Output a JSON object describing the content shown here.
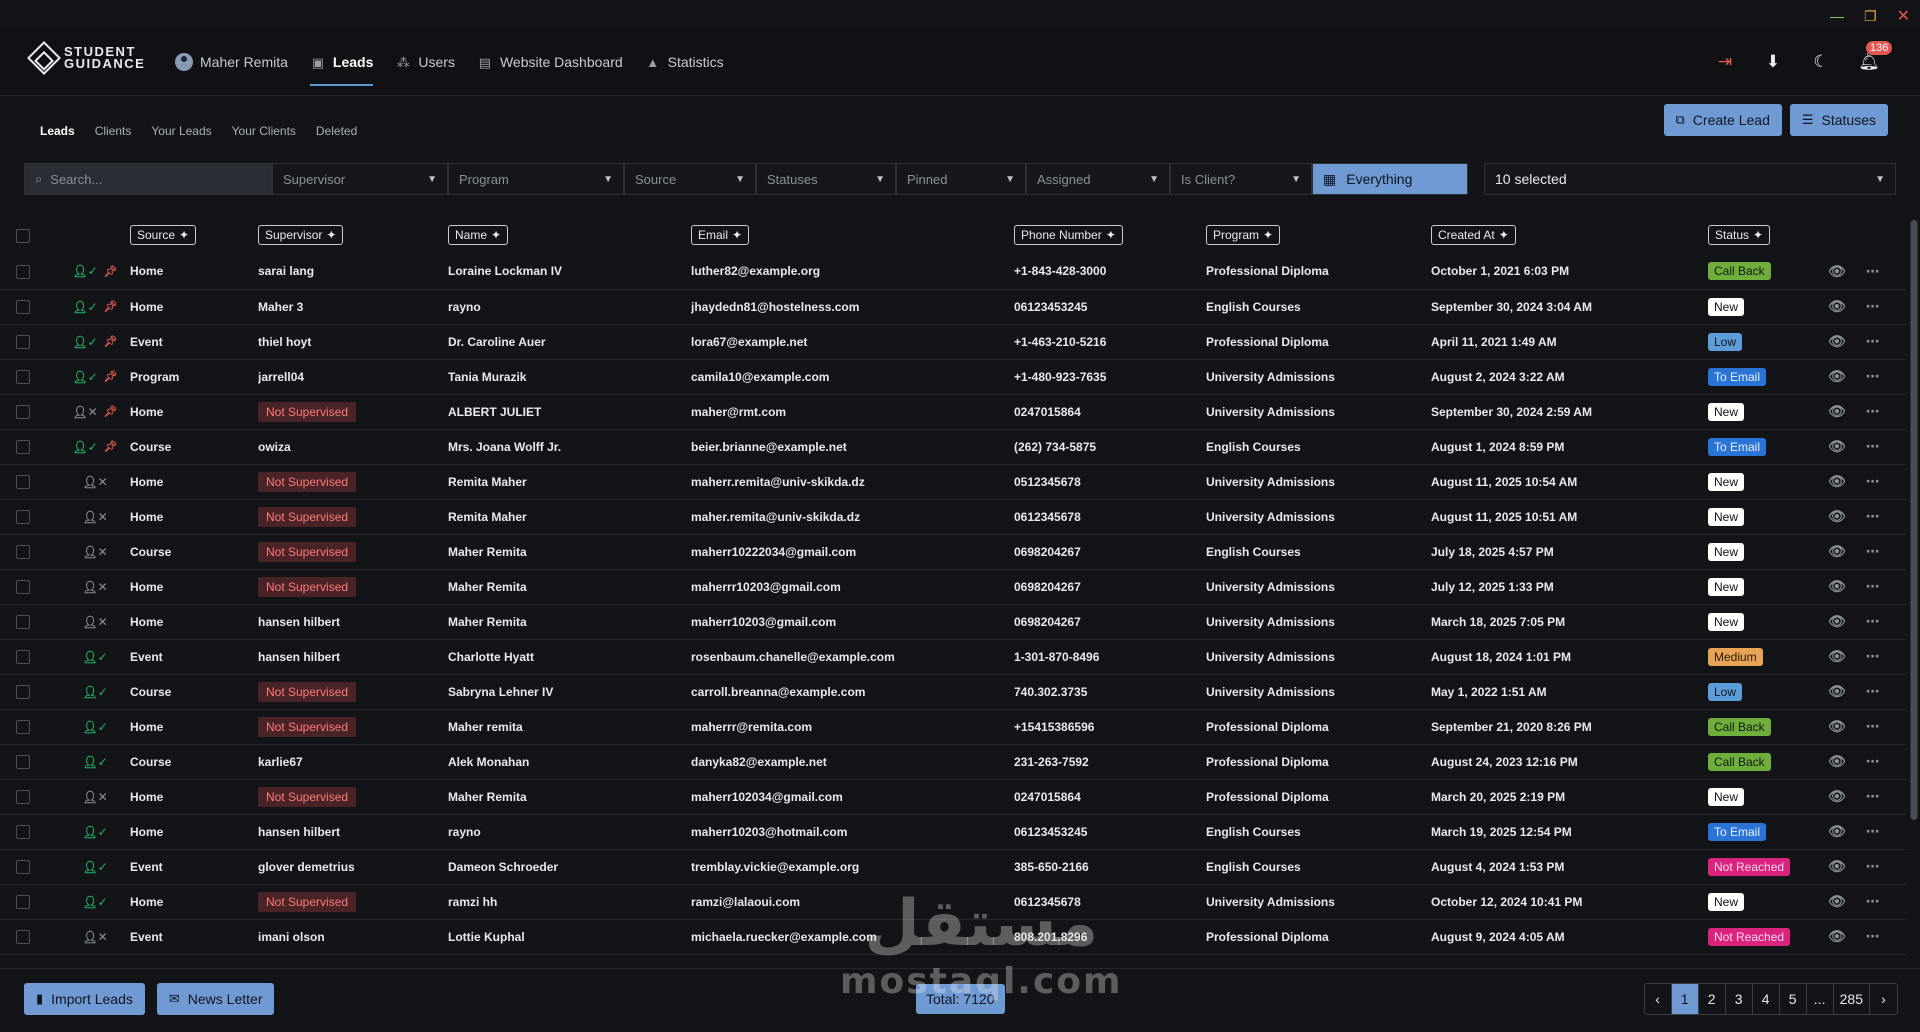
{
  "brand": {
    "line1": "STUDENT",
    "line2": "GUIDANCE"
  },
  "nav": {
    "user": "Maher Remita",
    "items": [
      "Leads",
      "Users",
      "Website Dashboard",
      "Statistics"
    ],
    "notifications": "136"
  },
  "subtabs": [
    "Leads",
    "Clients",
    "Your Leads",
    "Your Clients",
    "Deleted"
  ],
  "actions": {
    "create": "Create Lead",
    "statuses": "Statuses"
  },
  "filters": {
    "search_placeholder": "Search...",
    "supervisor": "Supervisor",
    "program": "Program",
    "source": "Source",
    "statuses": "Statuses",
    "pinned": "Pinned",
    "assigned": "Assigned",
    "is_client": "Is Client?",
    "everything": "Everything",
    "columns_selected": "10 selected"
  },
  "columns": [
    "Source",
    "Supervisor",
    "Name",
    "Email",
    "Phone Number",
    "Program",
    "Created At",
    "Status"
  ],
  "rows": [
    {
      "assigned": true,
      "pinned": true,
      "source": "Home",
      "supervisor": "sarai lang",
      "name": "Loraine Lockman IV",
      "email": "luther82@example.org",
      "phone": "+1-843-428-3000",
      "program": "Professional Diploma",
      "created": "October 1, 2021 6:03 PM",
      "status": "Call Back",
      "st": "callback"
    },
    {
      "assigned": true,
      "pinned": true,
      "source": "Home",
      "supervisor": "Maher 3",
      "name": "rayno",
      "email": "jhaydedn81@hostelness.com",
      "phone": "06123453245",
      "program": "English Courses",
      "created": "September 30, 2024 3:04 AM",
      "status": "New",
      "st": "new"
    },
    {
      "assigned": true,
      "pinned": true,
      "source": "Event",
      "supervisor": "thiel hoyt",
      "name": "Dr. Caroline Auer",
      "email": "lora67@example.net",
      "phone": "+1-463-210-5216",
      "program": "Professional Diploma",
      "created": "April 11, 2021 1:49 AM",
      "status": "Low",
      "st": "low"
    },
    {
      "assigned": true,
      "pinned": true,
      "source": "Program",
      "supervisor": "jarrell04",
      "name": "Tania Murazik",
      "email": "camila10@example.com",
      "phone": "+1-480-923-7635",
      "program": "University Admissions",
      "created": "August 2, 2024 3:22 AM",
      "status": "To Email",
      "st": "toemail"
    },
    {
      "assigned": false,
      "pinned": true,
      "source": "Home",
      "supervisor": "Not Supervised",
      "name": "ALBERT JULIET",
      "email": "maher@rmt.com",
      "phone": "0247015864",
      "program": "University Admissions",
      "created": "September 30, 2024 2:59 AM",
      "status": "New",
      "st": "new"
    },
    {
      "assigned": true,
      "pinned": true,
      "source": "Course",
      "supervisor": "owiza",
      "name": "Mrs. Joana Wolff Jr.",
      "email": "beier.brianne@example.net",
      "phone": "(262) 734-5875",
      "program": "English Courses",
      "created": "August 1, 2024 8:59 PM",
      "status": "To Email",
      "st": "toemail"
    },
    {
      "assigned": false,
      "pinned": false,
      "source": "Home",
      "supervisor": "Not Supervised",
      "name": "Remita Maher",
      "email": "maherr.remita@univ-skikda.dz",
      "phone": "0512345678",
      "program": "University Admissions",
      "created": "August 11, 2025 10:54 AM",
      "status": "New",
      "st": "new"
    },
    {
      "assigned": false,
      "pinned": false,
      "source": "Home",
      "supervisor": "Not Supervised",
      "name": "Remita Maher",
      "email": "maher.remita@univ-skikda.dz",
      "phone": "0612345678",
      "program": "University Admissions",
      "created": "August 11, 2025 10:51 AM",
      "status": "New",
      "st": "new"
    },
    {
      "assigned": false,
      "pinned": false,
      "source": "Course",
      "supervisor": "Not Supervised",
      "name": "Maher Remita",
      "email": "maherr10222034@gmail.com",
      "phone": "0698204267",
      "program": "English Courses",
      "created": "July 18, 2025 4:57 PM",
      "status": "New",
      "st": "new"
    },
    {
      "assigned": false,
      "pinned": false,
      "source": "Home",
      "supervisor": "Not Supervised",
      "name": "Maher Remita",
      "email": "maherrr10203@gmail.com",
      "phone": "0698204267",
      "program": "University Admissions",
      "created": "July 12, 2025 1:33 PM",
      "status": "New",
      "st": "new"
    },
    {
      "assigned": false,
      "pinned": false,
      "source": "Home",
      "supervisor": "hansen hilbert",
      "name": "Maher Remita",
      "email": "maherr10203@gmail.com",
      "phone": "0698204267",
      "program": "University Admissions",
      "created": "March 18, 2025 7:05 PM",
      "status": "New",
      "st": "new"
    },
    {
      "assigned": true,
      "pinned": false,
      "source": "Event",
      "supervisor": "hansen hilbert",
      "name": "Charlotte Hyatt",
      "email": "rosenbaum.chanelle@example.com",
      "phone": "1-301-870-8496",
      "program": "University Admissions",
      "created": "August 18, 2024 1:01 PM",
      "status": "Medium",
      "st": "medium"
    },
    {
      "assigned": true,
      "pinned": false,
      "source": "Course",
      "supervisor": "Not Supervised",
      "name": "Sabryna Lehner IV",
      "email": "carroll.breanna@example.com",
      "phone": "740.302.3735",
      "program": "University Admissions",
      "created": "May 1, 2022 1:51 AM",
      "status": "Low",
      "st": "low"
    },
    {
      "assigned": true,
      "pinned": false,
      "source": "Home",
      "supervisor": "Not Supervised",
      "name": "Maher remita",
      "email": "maherrr@remita.com",
      "phone": "+15415386596",
      "program": "Professional Diploma",
      "created": "September 21, 2020 8:26 PM",
      "status": "Call Back",
      "st": "callback"
    },
    {
      "assigned": true,
      "pinned": false,
      "source": "Course",
      "supervisor": "karlie67",
      "name": "Alek Monahan",
      "email": "danyka82@example.net",
      "phone": "231-263-7592",
      "program": "Professional Diploma",
      "created": "August 24, 2023 12:16 PM",
      "status": "Call Back",
      "st": "callback"
    },
    {
      "assigned": false,
      "pinned": false,
      "source": "Home",
      "supervisor": "Not Supervised",
      "name": "Maher Remita",
      "email": "maherr102034@gmail.com",
      "phone": "0247015864",
      "program": "Professional Diploma",
      "created": "March 20, 2025 2:19 PM",
      "status": "New",
      "st": "new"
    },
    {
      "assigned": true,
      "pinned": false,
      "source": "Home",
      "supervisor": "hansen hilbert",
      "name": "rayno",
      "email": "maherr10203@hotmail.com",
      "phone": "06123453245",
      "program": "English Courses",
      "created": "March 19, 2025 12:54 PM",
      "status": "To Email",
      "st": "toemail"
    },
    {
      "assigned": true,
      "pinned": false,
      "source": "Event",
      "supervisor": "glover demetrius",
      "name": "Dameon Schroeder",
      "email": "tremblay.vickie@example.org",
      "phone": "385-650-2166",
      "program": "English Courses",
      "created": "August 4, 2024 1:53 PM",
      "status": "Not Reached",
      "st": "notreached"
    },
    {
      "assigned": true,
      "pinned": false,
      "source": "Home",
      "supervisor": "Not Supervised",
      "name": "ramzi hh",
      "email": "ramzi@lalaoui.com",
      "phone": "0612345678",
      "program": "University Admissions",
      "created": "October 12, 2024 10:41 PM",
      "status": "New",
      "st": "new"
    },
    {
      "assigned": false,
      "pinned": false,
      "source": "Event",
      "supervisor": "imani olson",
      "name": "Lottie Kuphal",
      "email": "michaela.ruecker@example.com",
      "phone": "808.201.8296",
      "program": "Professional Diploma",
      "created": "August 9, 2024 4:05 AM",
      "status": "Not Reached",
      "st": "notreached"
    }
  ],
  "footer": {
    "import": "Import Leads",
    "newsletter": "News Letter",
    "total": "Total: 7120",
    "pages": [
      "1",
      "2",
      "3",
      "4",
      "5",
      "...",
      "285"
    ],
    "active_page": "1"
  },
  "watermark": {
    "line1": "مستقل",
    "line2": "mostaql.com"
  }
}
